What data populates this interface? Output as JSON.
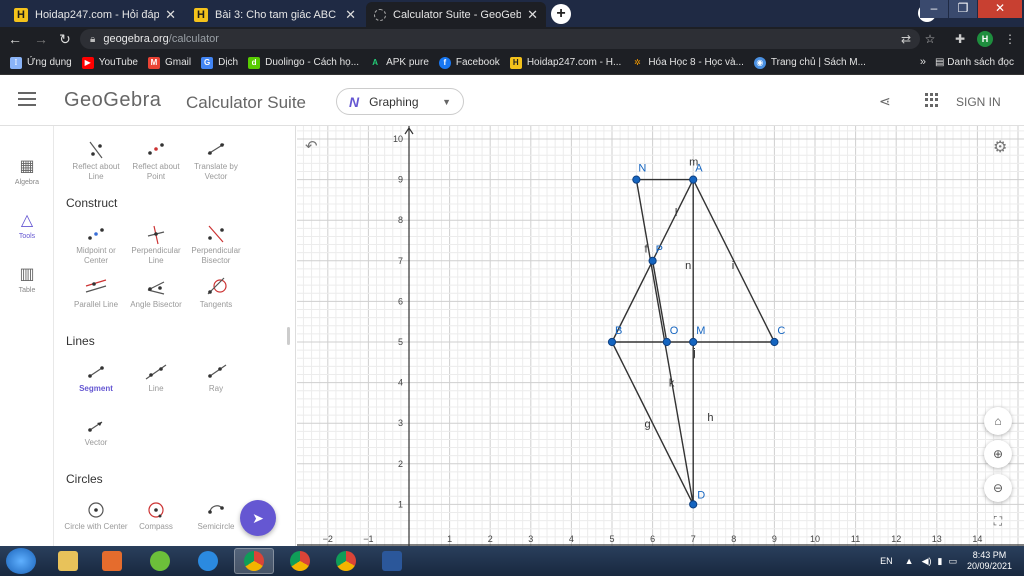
{
  "browser": {
    "tabs": [
      {
        "title": "Hoidap247.com - Hỏi đáp online",
        "favicon": "H",
        "active": false
      },
      {
        "title": "Bài 3: Cho tam giác ABC cân tại A",
        "favicon": "H",
        "active": false
      },
      {
        "title": "Calculator Suite - GeoGebra",
        "favicon": "geogebra-icon",
        "active": true
      }
    ],
    "new_tab": "+",
    "profile_initial": "H",
    "url_host": "geogebra.org",
    "url_path": "/calculator",
    "bookmarks": [
      {
        "label": "Ứng dụng",
        "color": "#8ab4f8"
      },
      {
        "label": "YouTube",
        "color": "#ff0000"
      },
      {
        "label": "Gmail",
        "color": "#ea4335"
      },
      {
        "label": "Dịch",
        "color": "#4285f4"
      },
      {
        "label": "Duolingo - Cách họ...",
        "color": "#58cc02"
      },
      {
        "label": "APK pure",
        "color": "#24cd77"
      },
      {
        "label": "Facebook",
        "color": "#1877f2"
      },
      {
        "label": "Hoidap247.com - H...",
        "color": "#f4c21b"
      },
      {
        "label": "Hóa Học 8 - Học và...",
        "color": "#f29900"
      },
      {
        "label": "Trang chủ | Sách M...",
        "color": "#4a90e2"
      }
    ],
    "bookmarks_more": "»",
    "reading_list": "Danh sách đọc"
  },
  "header": {
    "logo": "GeoGebra",
    "suite": "Calculator Suite",
    "app_selected": "Graphing",
    "sign_in": "SIGN IN"
  },
  "rail": [
    {
      "label": "Algebra",
      "icon": "calculator-icon",
      "selected": false
    },
    {
      "label": "Tools",
      "icon": "tools-icon",
      "selected": true
    },
    {
      "label": "Table",
      "icon": "table-icon",
      "selected": false
    }
  ],
  "tools": {
    "top_row": [
      "Reflect about Line",
      "Reflect about Point",
      "Translate by Vector"
    ],
    "sections": [
      {
        "title": "Construct",
        "rows": [
          [
            "Midpoint or Center",
            "Perpendicular Line",
            "Perpendicular Bisector"
          ],
          [
            "Parallel Line",
            "Angle Bisector",
            "Tangents"
          ]
        ]
      },
      {
        "title": "Lines",
        "rows": [
          [
            "Segment",
            "Line",
            "Ray"
          ],
          [
            "Vector"
          ]
        ]
      },
      {
        "title": "Circles",
        "rows": [
          [
            "Circle with Center",
            "Compass",
            "Semicircle"
          ]
        ]
      }
    ],
    "selected_tool": "Segment"
  },
  "graph": {
    "x_ticks": [
      "−2",
      "−1",
      "1",
      "2",
      "3",
      "4",
      "5",
      "6",
      "7",
      "8",
      "9",
      "10",
      "11",
      "12",
      "13",
      "14"
    ],
    "y_ticks": [
      "1",
      "2",
      "3",
      "4",
      "5",
      "6",
      "7",
      "8",
      "9",
      "10"
    ],
    "point_color": "#1565c0",
    "segment_color": "#333333",
    "label_color": "#1565c0",
    "points": [
      {
        "name": "A",
        "x": 7,
        "y": 9
      },
      {
        "name": "N",
        "x": 5.6,
        "y": 9
      },
      {
        "name": "P",
        "x": 6,
        "y": 7
      },
      {
        "name": "B",
        "x": 5,
        "y": 5
      },
      {
        "name": "O",
        "x": 6.35,
        "y": 5
      },
      {
        "name": "M",
        "x": 7,
        "y": 5
      },
      {
        "name": "C",
        "x": 9,
        "y": 5
      },
      {
        "name": "D",
        "x": 7,
        "y": 1
      }
    ],
    "segments": [
      {
        "name": "m",
        "from": "N",
        "to": "A"
      },
      {
        "name": "l",
        "from": "A",
        "to": "P"
      },
      {
        "name": "f",
        "from": "P",
        "to": "B"
      },
      {
        "name": "i",
        "from": "A",
        "to": "C"
      },
      {
        "name": "n",
        "from": "A",
        "to": "M"
      },
      {
        "name": "j",
        "from": "B",
        "to": "C"
      },
      {
        "name": "k",
        "from": "N",
        "to": "D"
      },
      {
        "name": "g",
        "from": "B",
        "to": "D"
      },
      {
        "name": "h",
        "from": "M",
        "to": "D"
      },
      {
        "name": "",
        "from": "P",
        "to": "O"
      }
    ],
    "segment_labels": [
      {
        "text": "m",
        "x": 6.9,
        "y": 9.35
      },
      {
        "text": "l",
        "x": 6.55,
        "y": 8.1
      },
      {
        "text": "f",
        "x": 5.8,
        "y": 7.2
      },
      {
        "text": "n",
        "x": 6.8,
        "y": 6.8
      },
      {
        "text": "i",
        "x": 7.95,
        "y": 6.8
      },
      {
        "text": "j",
        "x": 7.0,
        "y": 4.65
      },
      {
        "text": "k",
        "x": 6.4,
        "y": 3.9
      },
      {
        "text": "g",
        "x": 5.8,
        "y": 2.9
      },
      {
        "text": "h",
        "x": 7.35,
        "y": 3.05
      }
    ]
  },
  "taskbar": {
    "apps": [
      "file-explorer-icon",
      "media-player-icon",
      "app-icon",
      "ie-icon",
      "chrome-icon",
      "chrome-icon",
      "chrome-icon",
      "word-icon"
    ],
    "language": "EN",
    "time": "8:43 PM",
    "date": "20/09/2021"
  }
}
